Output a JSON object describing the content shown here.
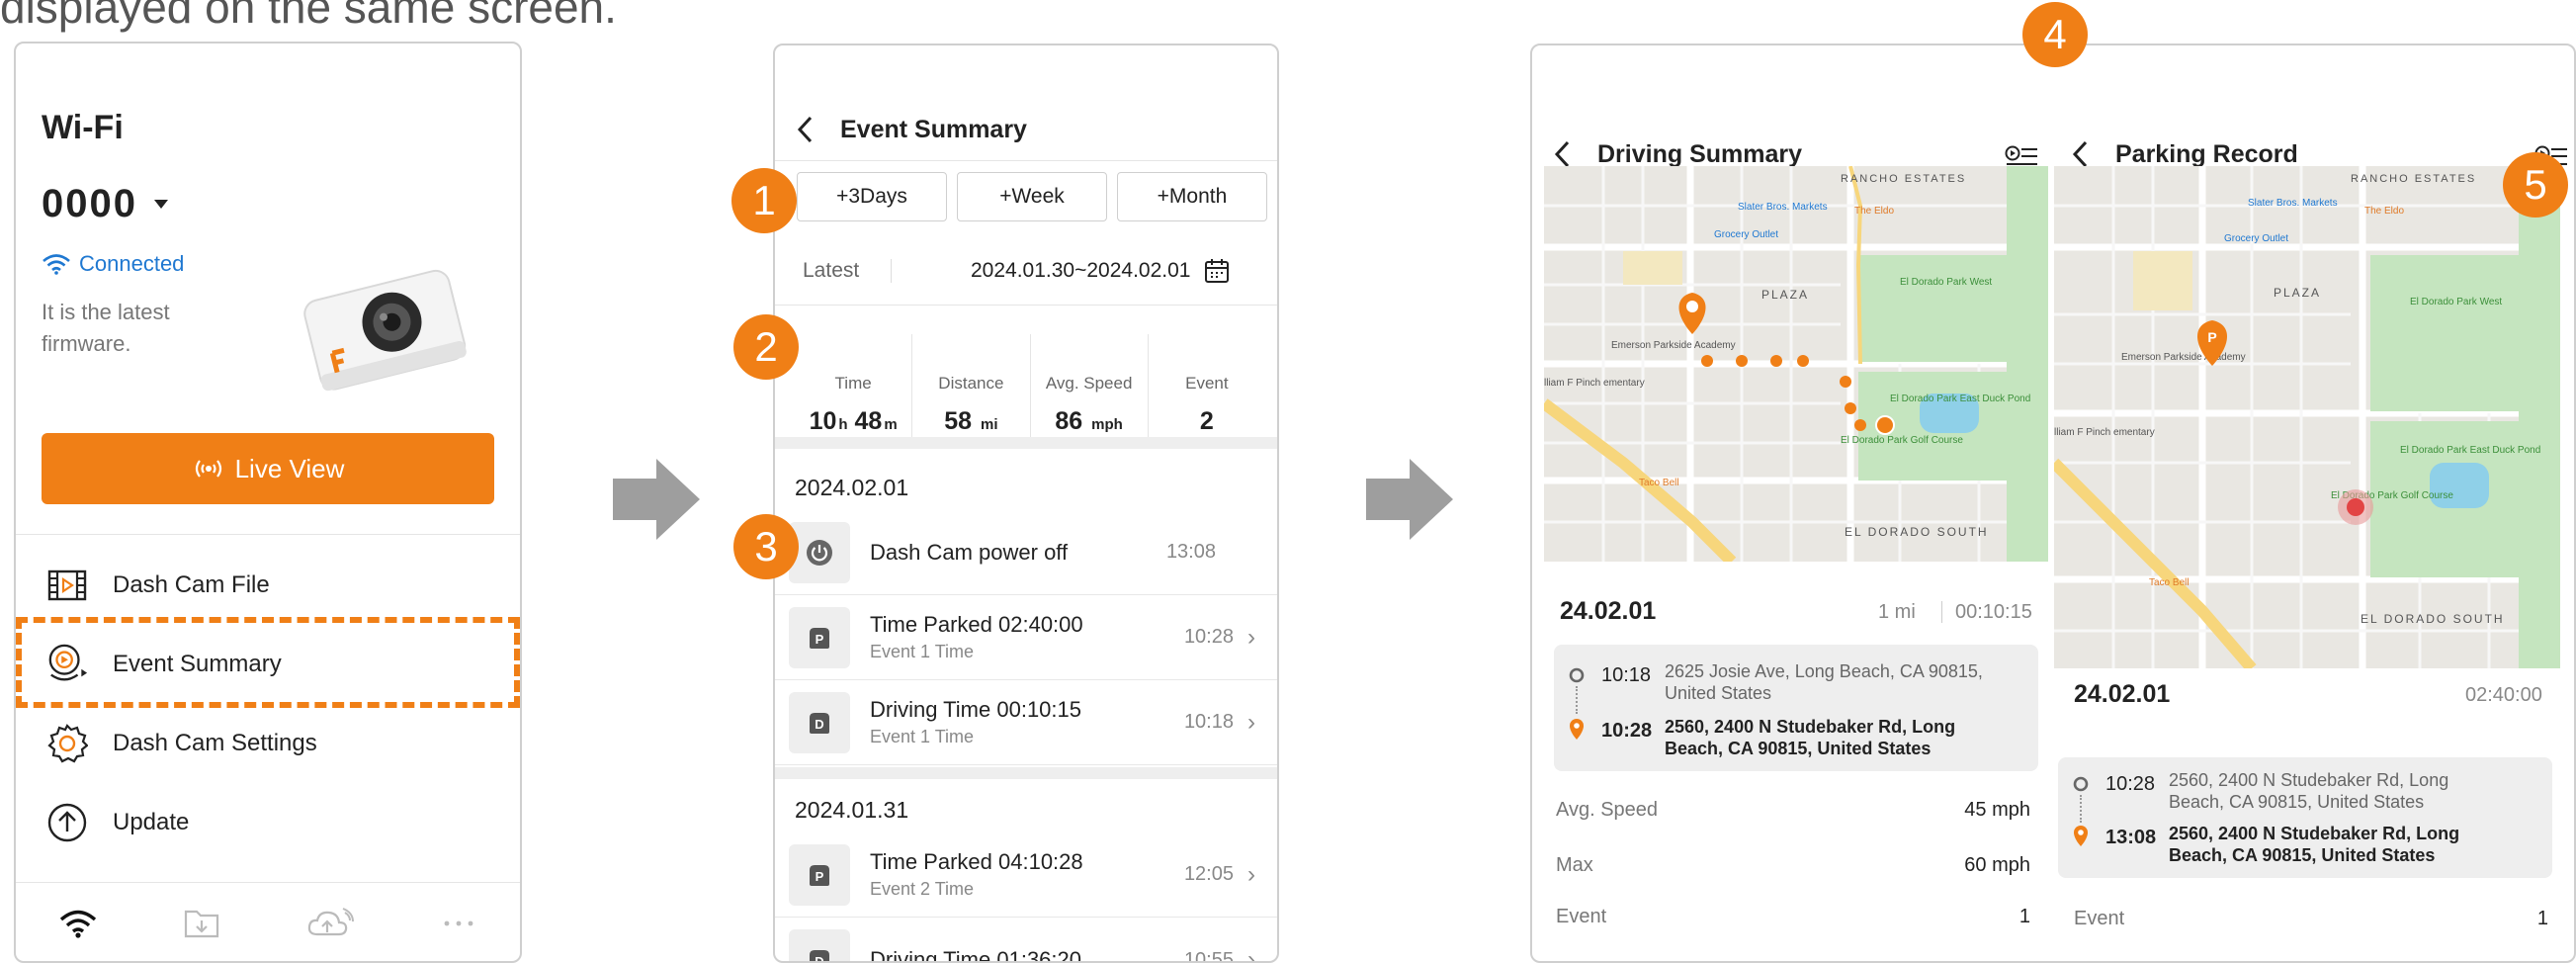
{
  "caption": "displayed on the same screen.",
  "colors": {
    "accent": "#f07f16",
    "link": "#1f78d1"
  },
  "panel1": {
    "wifi_title": "Wi-Fi",
    "ssid": "0000",
    "status": "Connected",
    "firmware_note": "It is the latest firmware.",
    "live_view": "Live View",
    "menu": [
      {
        "label": "Dash Cam File",
        "icon": "film-icon"
      },
      {
        "label": "Event Summary",
        "icon": "event-summary-icon"
      },
      {
        "label": "Dash Cam Settings",
        "icon": "gear-icon"
      },
      {
        "label": "Update",
        "icon": "upload-arrow-icon"
      }
    ],
    "bottom_nav": [
      "wifi-icon",
      "download-folder-icon",
      "cloud-upload-icon",
      "more-icon"
    ]
  },
  "panel2": {
    "title": "Event Summary",
    "range_buttons": [
      "+3Days",
      "+Week",
      "+Month"
    ],
    "latest_label": "Latest",
    "date_range": "2024.01.30~2024.02.01",
    "stats": {
      "time_label": "Time",
      "time_h": "10",
      "time_h_unit": "h",
      "time_m": "48",
      "time_m_unit": "m",
      "distance_label": "Distance",
      "distance": "58",
      "distance_unit": "mi",
      "speed_label": "Avg. Speed",
      "speed": "86",
      "speed_unit": "mph",
      "event_label": "Event",
      "event": "2"
    },
    "groups": [
      {
        "date": "2024.02.01",
        "events": [
          {
            "title": "Dash Cam power off",
            "sub": "",
            "time": "13:08",
            "icon": "power-icon"
          },
          {
            "title": "Time Parked  02:40:00",
            "sub": "Event 1 Time",
            "time": "10:28",
            "icon": "parking-icon"
          },
          {
            "title": "Driving Time  00:10:15",
            "sub": "Event 1 Time",
            "time": "10:18",
            "icon": "driving-icon"
          }
        ]
      },
      {
        "date": "2024.01.31",
        "events": [
          {
            "title": "Time Parked  04:10:28",
            "sub": "Event 2 Time",
            "time": "12:05",
            "icon": "parking-icon"
          },
          {
            "title": "Driving Time  01:36:20",
            "sub": "",
            "time": "10:55",
            "icon": "driving-icon"
          }
        ]
      }
    ]
  },
  "panel3": {
    "driving": {
      "title": "Driving Summary",
      "date": "24.02.01",
      "distance": "1 mi",
      "duration": "00:10:15",
      "start_time": "10:18",
      "start_addr_1": "2625 Josie Ave, Long Beach,  CA 90815,",
      "start_addr_2": "United States",
      "end_time": "10:28",
      "end_addr_1": "2560, 2400 N Studebaker Rd, Long",
      "end_addr_2": "Beach, CA 90815, United States",
      "avg_speed_label": "Avg. Speed",
      "avg_speed": "45 mph",
      "max_label": "Max",
      "max": "60 mph",
      "event_label": "Event",
      "event": "1"
    },
    "parking": {
      "title": "Parking Record",
      "date": "24.02.01",
      "duration": "02:40:00",
      "start_time": "10:28",
      "start_addr_1": "2560, 2400 N Studebaker Rd, Long",
      "start_addr_2": "Beach, CA 90815, United States",
      "end_time": "13:08",
      "end_addr_1": "2560, 2400 N Studebaker Rd, Long",
      "end_addr_2": "Beach, CA 90815, United States",
      "event_label": "Event",
      "event": "1"
    },
    "map_labels": {
      "rancho": "RANCHO ESTATES",
      "slater": "Slater Bros. Markets",
      "eldo": "The Eldo",
      "grocery": "Grocery Outlet",
      "plaza": "PLAZA",
      "park_west": "El Dorado Park West",
      "emerson": "Emerson Parkside Academy",
      "duck_pond": "El Dorado Park East Duck Pond",
      "golf": "El Dorado Park Golf Course",
      "taco": "Taco Bell",
      "el_dorado_south": "EL DORADO SOUTH",
      "pinch": "lliam F Pinch ementary"
    }
  },
  "badges": [
    "1",
    "2",
    "3",
    "4",
    "5"
  ]
}
